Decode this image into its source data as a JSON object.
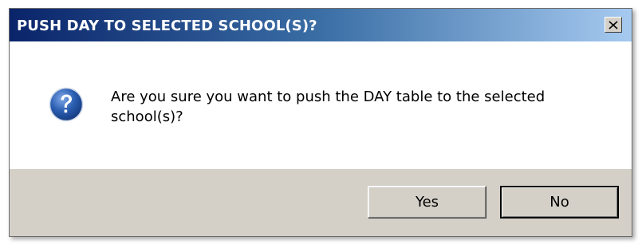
{
  "dialog": {
    "title": "PUSH DAY TO SELECTED SCHOOL(S)?",
    "message": "Are you sure you want to push the DAY table to the selected school(s)?",
    "icon": "question-icon",
    "buttons": {
      "yes_label": "Yes",
      "no_label": "No"
    },
    "close_icon": "close-icon"
  },
  "colors": {
    "titlebar_start": "#0a246a",
    "titlebar_end": "#a6caf0",
    "button_face": "#d4d0c8",
    "icon_blue": "#2a5db0"
  }
}
